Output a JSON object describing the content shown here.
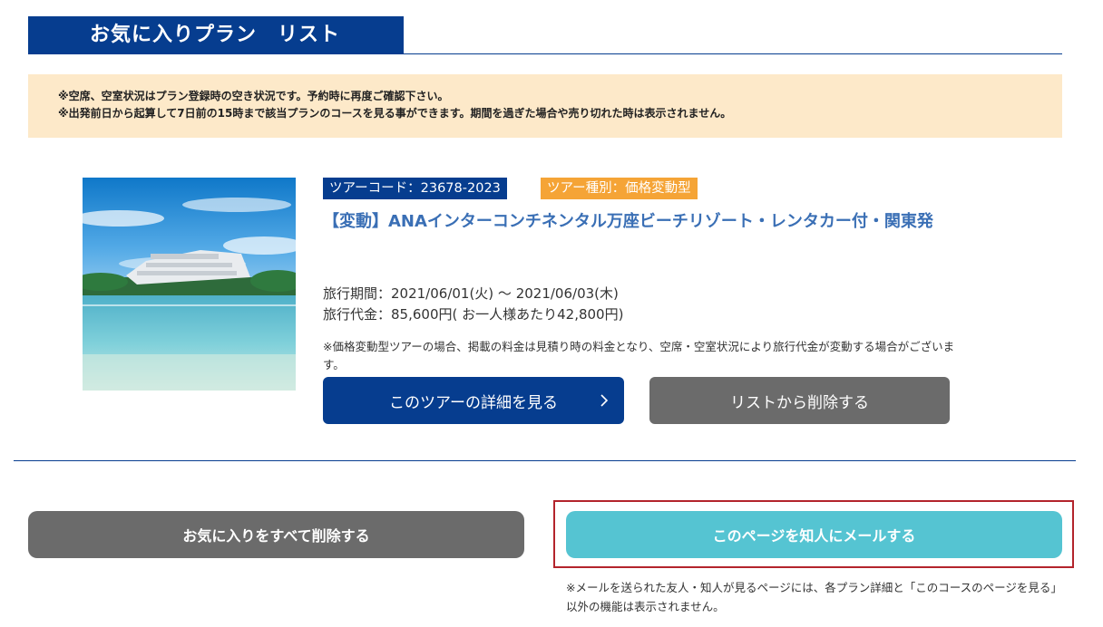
{
  "header": {
    "title": "お気に入りプラン　リスト"
  },
  "notice": {
    "line1": "※空席、空室状況はプラン登録時の空き状況です。予約時に再度ご確認下さい。",
    "line2": "※出発前日から起算して7日前の15時まで該当プランのコースを見る事ができます。期間を過ぎた場合や売り切れた時は表示されません。"
  },
  "plan": {
    "tour_code": "ツアーコード：23678-2023",
    "tour_type": "ツアー種別：価格変動型",
    "title": "【変動】ANAインターコンチネンタル万座ビーチリゾート・レンタカー付・関東発",
    "period": "旅行期間：2021/06/01(火) 〜 2021/06/03(木)",
    "price": "旅行代金：85,600円( お一人様あたり42,800円)",
    "note": "※価格変動型ツアーの場合、掲載の料金は見積り時の料金となり、空席・空室状況により旅行代金が変動する場合がございます。",
    "detail_button": "このツアーの詳細を見る",
    "remove_button": "リストから削除する"
  },
  "footer": {
    "remove_all_button": "お気に入りをすべて削除する",
    "mail_button": "このページを知人にメールする",
    "mail_note": "※メールを送られた友人・知人が見るページには、各プラン詳細と「このコースのページを見る」以外の機能は表示されません。"
  },
  "colors": {
    "brand_navy": "#063d8f",
    "accent_orange": "#f5a436",
    "title_blue": "#3a6fb5",
    "notice_bg": "#fde9c9",
    "mail_button": "#55c4d2",
    "gray_button": "#6b6b6b",
    "highlight_red": "#b3242c"
  },
  "icons": {
    "detail_chevron": "chevron-right-icon"
  }
}
